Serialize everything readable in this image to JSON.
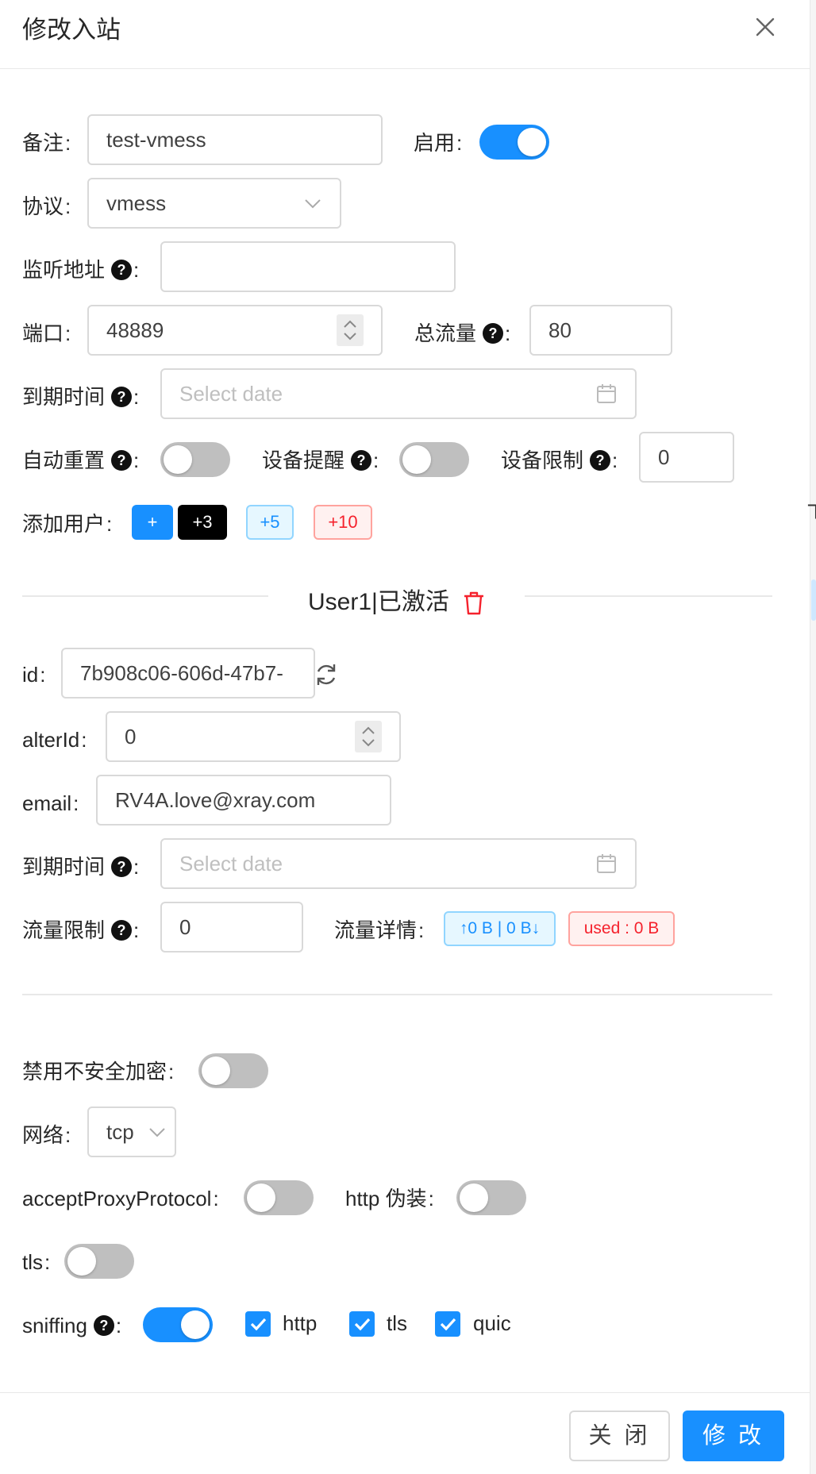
{
  "modal": {
    "title": "修改入站"
  },
  "form": {
    "remark": {
      "label": "备注",
      "value": "test-vmess"
    },
    "enable": {
      "label": "启用",
      "on": true
    },
    "protocol": {
      "label": "协议",
      "value": "vmess"
    },
    "listen": {
      "label": "监听地址",
      "value": ""
    },
    "port": {
      "label": "端口",
      "value": "48889"
    },
    "total_traffic": {
      "label": "总流量",
      "value": "80"
    },
    "expiry": {
      "label": "到期时间",
      "placeholder": "Select date"
    },
    "auto_reset": {
      "label": "自动重置",
      "on": false
    },
    "device_alert": {
      "label": "设备提醒",
      "on": false
    },
    "device_limit": {
      "label": "设备限制",
      "value": "0"
    },
    "add_user": {
      "label": "添加用户",
      "buttons": [
        "+",
        "+3",
        "+5",
        "+10"
      ]
    }
  },
  "user": {
    "header": "User1|已激活",
    "id": {
      "label": "id",
      "value": "7b908c06-606d-47b7-"
    },
    "alter_id": {
      "label": "alterId",
      "value": "0"
    },
    "email": {
      "label": "email",
      "value": "RV4A.love@xray.com"
    },
    "expiry": {
      "label": "到期时间",
      "placeholder": "Select date"
    },
    "traffic_limit": {
      "label": "流量限制",
      "value": "0"
    },
    "traffic_detail": {
      "label": "流量详情",
      "updown": "↑0 B | 0 B↓",
      "used": "used : 0 B"
    }
  },
  "settings": {
    "disable_insecure": {
      "label": "禁用不安全加密",
      "on": false
    },
    "network": {
      "label": "网络",
      "value": "tcp"
    },
    "accept_proxy": {
      "label": "acceptProxyProtocol",
      "on": false
    },
    "http_camouflage": {
      "label": "http 伪装",
      "on": false
    },
    "tls": {
      "label": "tls",
      "on": false
    },
    "sniffing": {
      "label": "sniffing",
      "on": true,
      "options": [
        "http",
        "tls",
        "quic"
      ]
    }
  },
  "footer": {
    "close_label": "关 闭",
    "submit_label": "修 改"
  },
  "colors": {
    "primary": "#1890ff",
    "danger": "#f5222d",
    "border": "#d9d9d9",
    "switch_off": "#bfbfbf"
  },
  "icons": [
    "close-icon",
    "question-icon",
    "calendar-icon",
    "chevron-down-icon",
    "stepper-icon",
    "trash-icon",
    "refresh-icon",
    "check-icon"
  ]
}
